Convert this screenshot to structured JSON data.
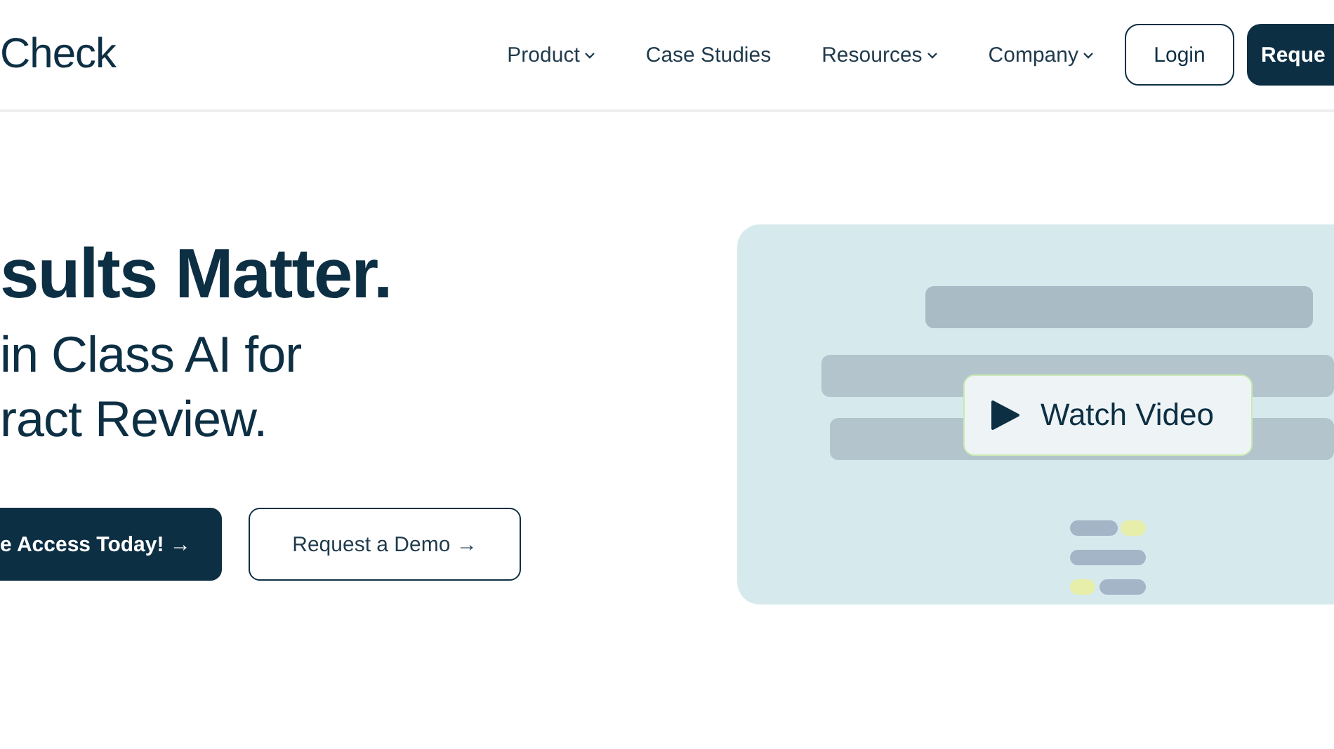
{
  "header": {
    "logo": "Check",
    "nav": [
      {
        "label": "Product",
        "dropdown": true
      },
      {
        "label": "Case Studies",
        "dropdown": false
      },
      {
        "label": "Resources",
        "dropdown": true
      },
      {
        "label": "Company",
        "dropdown": true
      }
    ],
    "login": "Login",
    "cta": "Reque"
  },
  "hero": {
    "title": "sults Matter.",
    "subtitle_lines": [
      "in Class AI for",
      "ract Review."
    ],
    "primary_button": "e Access Today! →",
    "secondary_button": "Request a Demo →"
  },
  "video": {
    "kind": "picture",
    "button": "Watch Video"
  }
}
